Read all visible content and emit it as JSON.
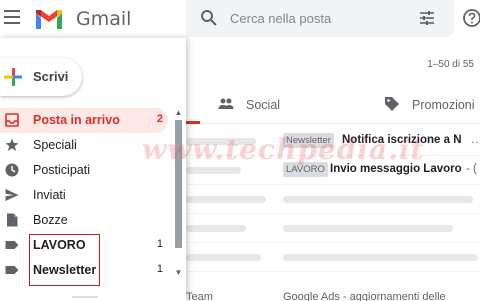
{
  "header": {
    "brand": "Gmail",
    "search_placeholder": "Cerca nella posta"
  },
  "compose": {
    "label": "Scrivi"
  },
  "sidebar": {
    "items": [
      {
        "label": "Posta in arrivo",
        "count": "2",
        "icon": "inbox-icon",
        "active": true
      },
      {
        "label": "Speciali",
        "count": "",
        "icon": "star-icon"
      },
      {
        "label": "Posticipati",
        "count": "",
        "icon": "clock-icon"
      },
      {
        "label": "Inviati",
        "count": "",
        "icon": "send-icon"
      },
      {
        "label": "Bozze",
        "count": "",
        "icon": "draft-icon"
      },
      {
        "label": "LAVORO",
        "count": "1",
        "icon": "label-icon"
      },
      {
        "label": "Newsletter",
        "count": "1",
        "icon": "label-icon"
      }
    ]
  },
  "main": {
    "page_range": "1–50 di 55",
    "tabs": [
      {
        "label": "Social",
        "icon": "people-icon"
      },
      {
        "label": "Promozioni",
        "icon": "tag-icon"
      }
    ],
    "rows": [
      {
        "tag": "Newsletter",
        "subject": "Notifica iscrizione a N",
        "rest": "…"
      },
      {
        "tag": "LAVORO",
        "subject": "Invio messaggio Lavoro",
        "rest": "- ("
      }
    ],
    "bottom_sender": "Team",
    "bottom_subject": "Google Ads - aggiornamenti delle"
  },
  "watermark": "www.techpedia.it",
  "colors": {
    "accent": "#d93025",
    "active_bg": "#fce8e6",
    "search_bg": "#f1f3f4"
  }
}
